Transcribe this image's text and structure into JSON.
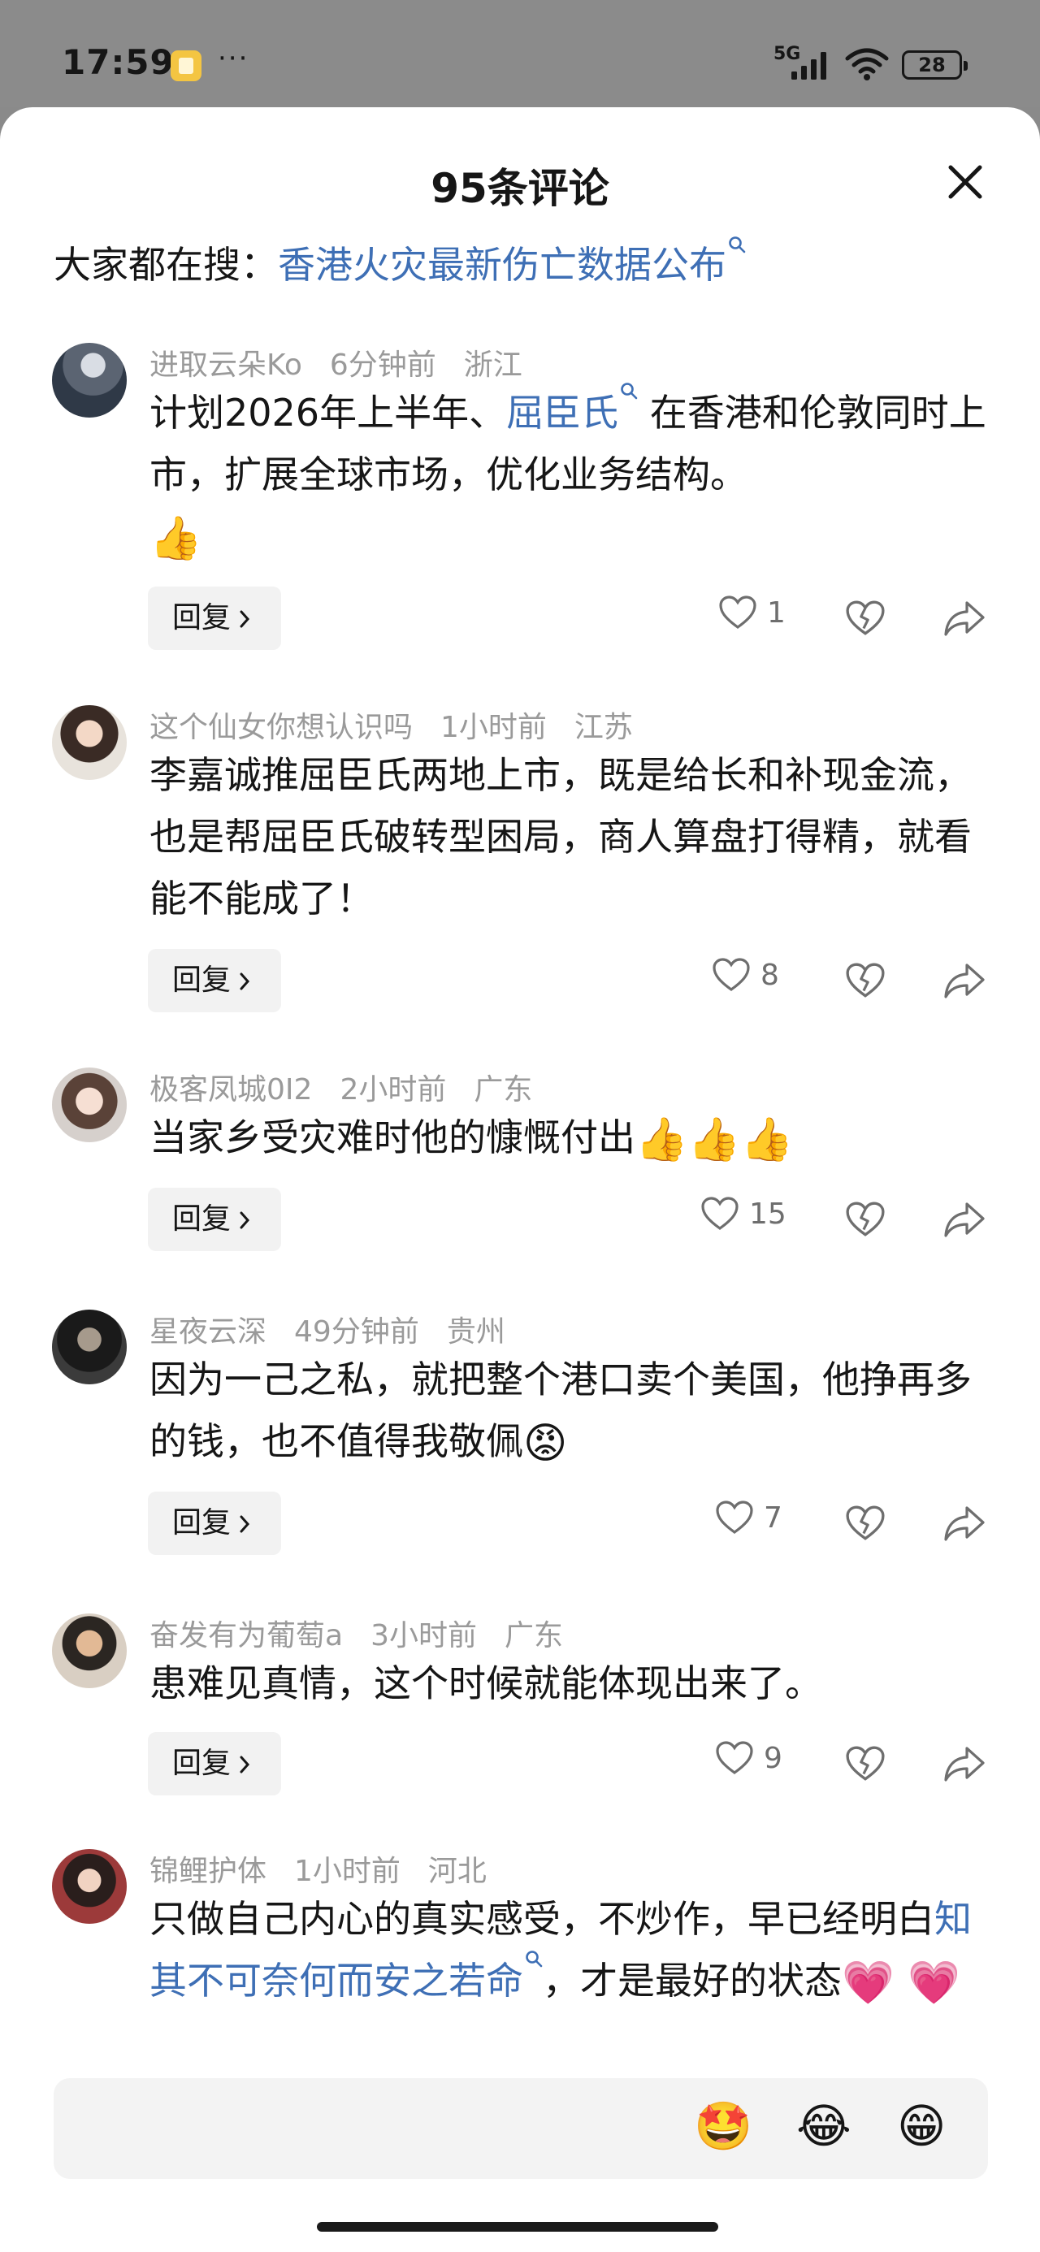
{
  "status_bar": {
    "time": "17:59",
    "more": "···",
    "network": "5G",
    "battery": "28"
  },
  "sheet": {
    "title": "95条评论",
    "hot_search_prefix": "大家都在搜：",
    "hot_search_query": "香港火灾最新伤亡数据公布"
  },
  "reply_label": "回复",
  "comments": [
    {
      "user": "进取云朵Ko",
      "time": "6分钟前",
      "location": "浙江",
      "text_a": "计划2026年上半年、",
      "link": "屈臣氏",
      "text_b": " 在香港和伦敦同时上市，扩展全球市场，优化业务结构。",
      "emoji": "👍",
      "likes": "1"
    },
    {
      "user": "这个仙女你想认识吗",
      "time": "1小时前",
      "location": "江苏",
      "text": "李嘉诚推屈臣氏两地上市，既是给长和补现金流，也是帮屈臣氏破转型困局，商人算盘打得精，就看能不能成了！",
      "likes": "8"
    },
    {
      "user": "极客凤城0I2",
      "time": "2小时前",
      "location": "广东",
      "text": "当家乡受灾难时他的慷慨付出",
      "emoji": "👍👍👍",
      "likes": "15"
    },
    {
      "user": "星夜云深",
      "time": "49分钟前",
      "location": "贵州",
      "text": "因为一己之私，就把整个港口卖个美国，他挣再多的钱，也不值得我敬佩",
      "emoji": "😡",
      "likes": "7"
    },
    {
      "user": "奋发有为葡萄a",
      "time": "3小时前",
      "location": "广东",
      "text": "患难见真情，这个时候就能体现出来了。",
      "likes": "9"
    },
    {
      "user": "锦鲤护体",
      "time": "1小时前",
      "location": "河北",
      "text_a": "只做自己内心的真实感受，不炒作，早已经明白",
      "link": "知其不可奈何而安之若命",
      "text_b": "，才是最好的状态",
      "emoji": "💗 💗"
    }
  ],
  "input_bar": {
    "emojis": [
      "🤩",
      "😂",
      "😁"
    ]
  },
  "colors": {
    "link": "#3e6fb5",
    "meta_gray": "#9a9a9a",
    "status_bg": "#8b8b8b"
  },
  "icons": [
    "search-icon",
    "close-icon",
    "heart-icon",
    "broken-heart-icon",
    "share-icon",
    "chevron-right-icon",
    "wifi-icon",
    "signal-icon",
    "battery-icon"
  ]
}
